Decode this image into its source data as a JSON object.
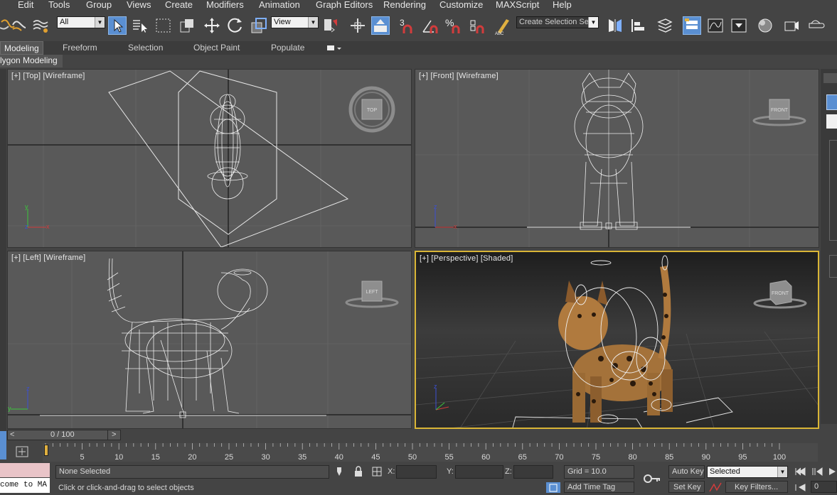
{
  "menu": [
    "Edit",
    "Tools",
    "Group",
    "Views",
    "Create",
    "Modifiers",
    "Animation",
    "Graph Editors",
    "Rendering",
    "Customize",
    "MAXScript",
    "Help"
  ],
  "toolbar": {
    "filter_value": "All",
    "refcoord_value": "View",
    "selection_set_placeholder": "Create Selection Se",
    "snap_3": "3"
  },
  "ribbon": {
    "tabs": [
      "Modeling",
      "Freeform",
      "Selection",
      "Object Paint",
      "Populate"
    ],
    "active_tab": "Modeling",
    "subpanel": "lygon Modeling"
  },
  "viewports": {
    "top": {
      "label": "[+] [Top] [Wireframe]",
      "cube": "TOP"
    },
    "front": {
      "label": "[+] [Front] [Wireframe]",
      "cube": "FRONT"
    },
    "left": {
      "label": "[+] [Left] [Wireframe]",
      "cube": "LEFT"
    },
    "perspective": {
      "label": "[+] [Perspective] [Shaded]",
      "cube": "FRONT"
    }
  },
  "timeline": {
    "frame_display": "0 / 100",
    "prev": "<",
    "next": ">",
    "ticks": [
      "5",
      "10",
      "15",
      "20",
      "25",
      "30",
      "35",
      "40",
      "45",
      "50",
      "55",
      "60",
      "65",
      "70",
      "75",
      "80",
      "85",
      "90",
      "95",
      "100"
    ],
    "current_frame": 0
  },
  "status": {
    "maxscript_listener": "come to MA",
    "selection": "None Selected",
    "prompt": "Click or click-and-drag to select objects",
    "x_label": "X:",
    "y_label": "Y:",
    "z_label": "Z:",
    "grid": "Grid = 10.0",
    "add_time_tag": "Add Time Tag",
    "auto_key": "Auto Key",
    "set_key": "Set Key",
    "key_mode_value": "Selected",
    "key_filters": "Key Filters...",
    "frame_field": "0"
  },
  "colors": {
    "active_viewport_border": "#d9b536",
    "accent_blue": "#5a8fd2",
    "axis_x": "#d23c3c",
    "axis_y": "#3cc83c",
    "axis_z": "#3c50d2"
  }
}
